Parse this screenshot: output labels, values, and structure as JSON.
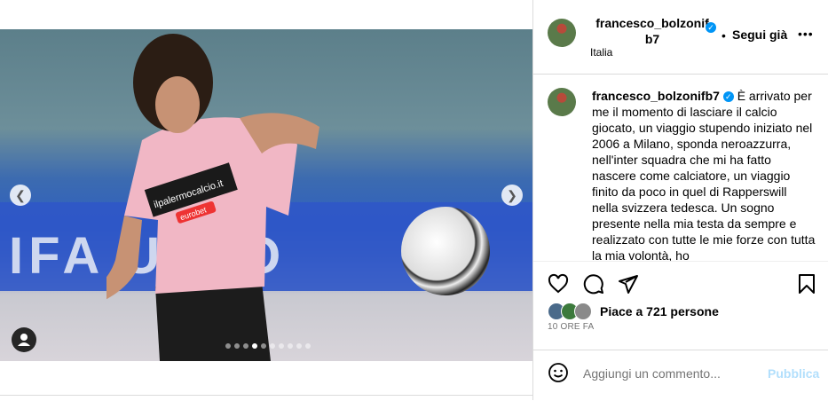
{
  "post": {
    "username": "francesco_bolzonifb7",
    "username_wrapped": [
      "francesco_bolzonif",
      "b7"
    ],
    "location": "Italia",
    "follow_label": "Segui già",
    "more_label": "•••",
    "caption": "È arrivato per me il momento di lasciare il calcio giocato, un viaggio stupendo iniziato nel 2006 a Milano, sponda neroazzurra, nell'inter squadra che mi ha fatto nascere come calciatore, un viaggio finito da poco in quel di Rapperswill nella svizzera tedesca. Un sogno presente nella mia testa da sempre e realizzato con tutte le mie forze con tutta la mia volontà, ho",
    "likes_text": "Piace a 721 persone",
    "timestamp": "10 ORE FA",
    "comment_placeholder": "Aggiungi un commento...",
    "publish_label": "Pubblica"
  },
  "photo": {
    "sponsor_text": "ilpalermocalcio.it",
    "sponsor_brand": "eurobet",
    "banner_text": "IFA  USTO"
  },
  "carousel": {
    "total_slides": 10,
    "active_index": 3
  },
  "icons": {
    "prev": "chevron-left-icon",
    "next": "chevron-right-icon",
    "tag": "user-tag-icon",
    "like": "heart-icon",
    "comment": "comment-icon",
    "share": "share-icon",
    "save": "bookmark-icon",
    "emoji": "emoji-icon"
  },
  "colors": {
    "accent": "#0095f6",
    "publish_disabled": "#b2dffc",
    "jersey_pink": "#f1b7c5"
  }
}
